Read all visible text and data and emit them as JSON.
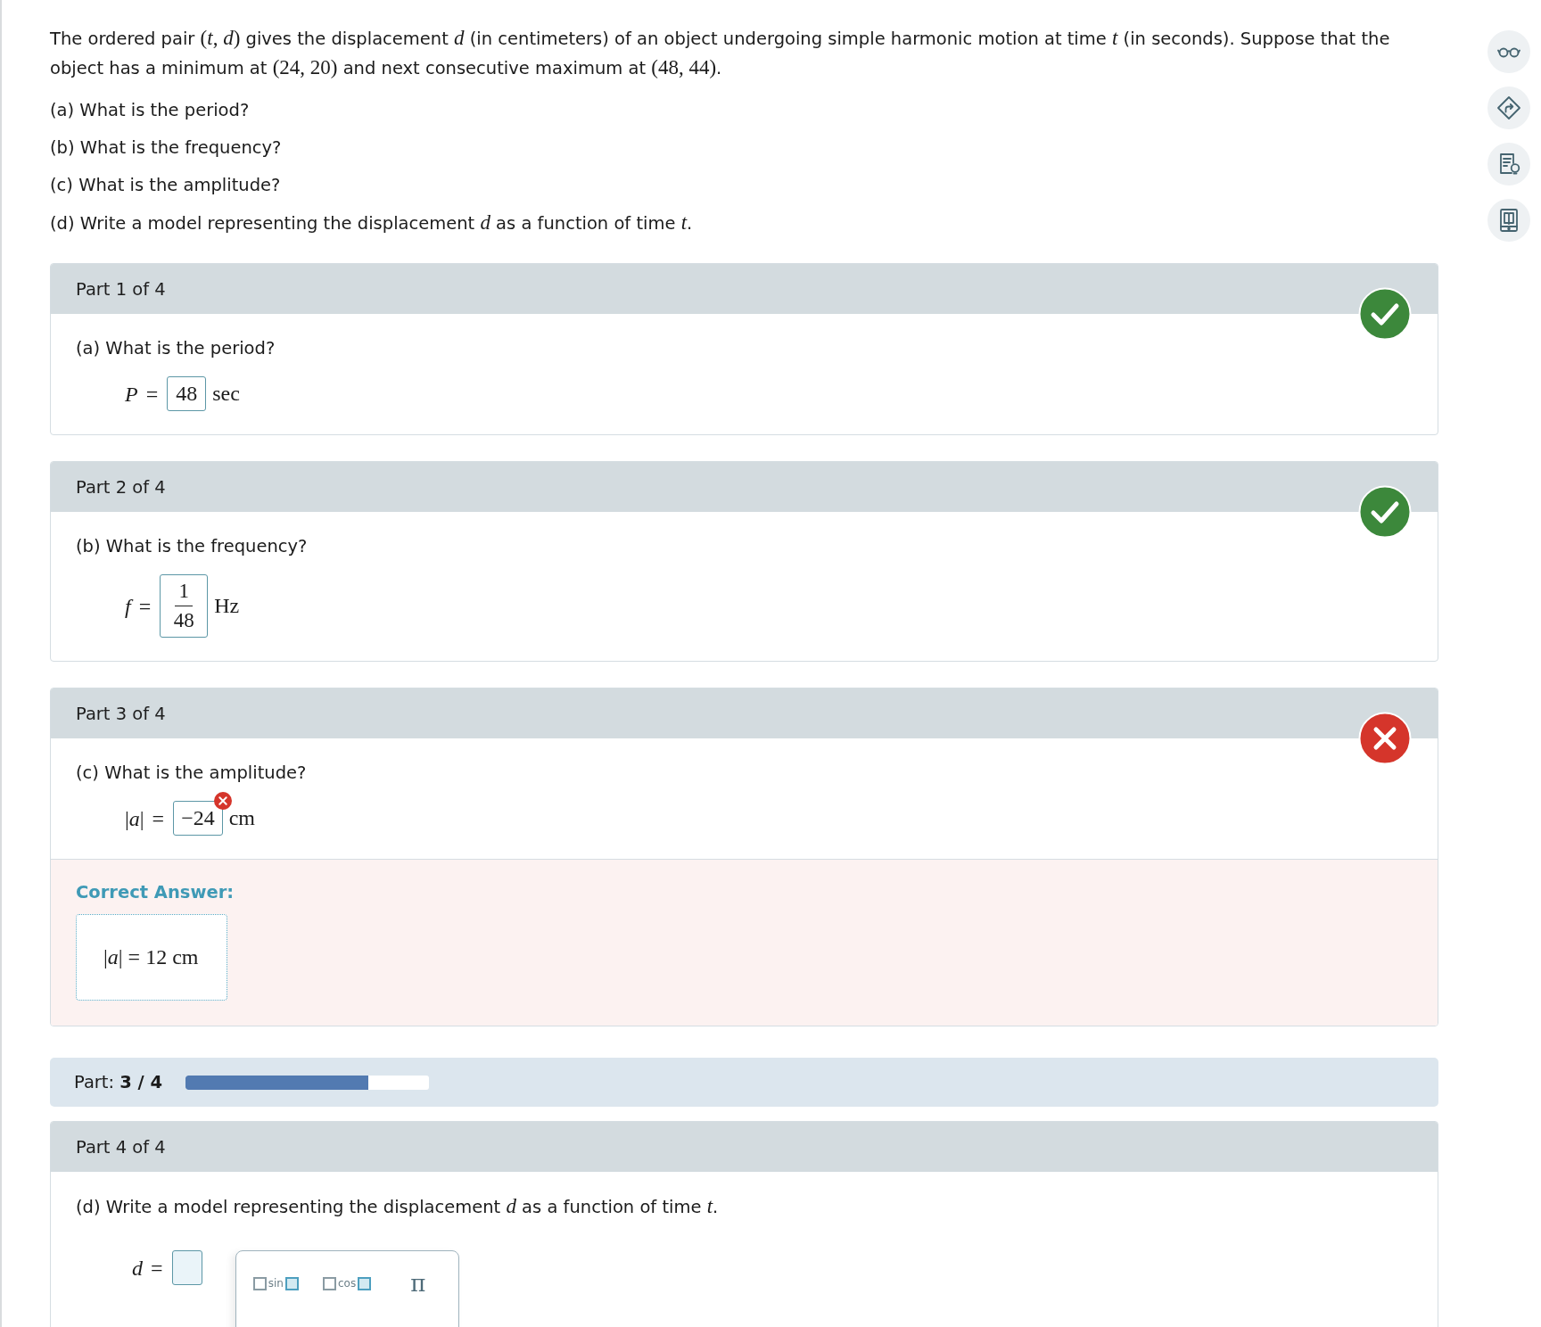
{
  "problem": {
    "statement": [
      {
        "kind": "text",
        "text": "The ordered pair "
      },
      {
        "kind": "math",
        "text": "(*t*, *d*)"
      },
      {
        "kind": "text",
        "text": " gives the displacement "
      },
      {
        "kind": "math",
        "text": "*d*"
      },
      {
        "kind": "text",
        "text": " (in centimeters) of an object undergoing simple harmonic motion at time "
      },
      {
        "kind": "math",
        "text": "*t*"
      },
      {
        "kind": "text",
        "text": " (in seconds). Suppose that the object has a minimum at "
      },
      {
        "kind": "math",
        "text": "(24, 20)"
      },
      {
        "kind": "text",
        "text": " and next consecutive maximum at "
      },
      {
        "kind": "math",
        "text": "(48, 44)"
      },
      {
        "kind": "text",
        "text": "."
      }
    ],
    "questions": [
      {
        "segments": [
          {
            "kind": "text",
            "text": "(a) What is the period?"
          }
        ]
      },
      {
        "segments": [
          {
            "kind": "text",
            "text": "(b) What is the frequency?"
          }
        ]
      },
      {
        "segments": [
          {
            "kind": "text",
            "text": "(c) What is the amplitude?"
          }
        ]
      },
      {
        "segments": [
          {
            "kind": "text",
            "text": "(d) Write a model representing the displacement "
          },
          {
            "kind": "math",
            "text": "*d*"
          },
          {
            "kind": "text",
            "text": " as a function of time "
          },
          {
            "kind": "math",
            "text": "*t*"
          },
          {
            "kind": "text",
            "text": "."
          }
        ]
      }
    ]
  },
  "sections": [
    {
      "kind": "part",
      "header": "Part 1 of 4",
      "correct": true,
      "question": [
        {
          "kind": "text",
          "text": "(a) What is the period?"
        }
      ],
      "answer": {
        "kind": "single",
        "lhs": "*P* =",
        "value": "48",
        "unit": "sec"
      }
    },
    {
      "kind": "part",
      "header": "Part 2 of 4",
      "correct": true,
      "question": [
        {
          "kind": "text",
          "text": "(b) What is the frequency?"
        }
      ],
      "answer": {
        "kind": "fraction",
        "lhs": "*f* =",
        "numerator": "1",
        "denominator": "48",
        "unit": "Hz"
      }
    },
    {
      "kind": "part",
      "header": "Part 3 of 4",
      "correct": false,
      "question": [
        {
          "kind": "text",
          "text": "(c) What is the amplitude?"
        }
      ],
      "answer": {
        "kind": "single",
        "lhs": "|*a*| =",
        "value": "−24",
        "unit": "cm",
        "wrong": true
      },
      "correct_answer": {
        "label": "Correct Answer:",
        "formula": "|*a*| = 12 cm"
      }
    },
    {
      "kind": "progress",
      "label": "Part: **3 / 4**",
      "level": 0.75
    },
    {
      "kind": "part",
      "header": "Part 4 of 4",
      "question": [
        {
          "kind": "text",
          "text": "(d) Write a model representing the displacement "
        },
        {
          "kind": "math",
          "text": "*d*"
        },
        {
          "kind": "text",
          "text": " as a function of time "
        },
        {
          "kind": "math",
          "text": "*t*"
        },
        {
          "kind": "text",
          "text": "."
        }
      ],
      "answer": {
        "kind": "template",
        "lhs": "*d* =",
        "keypad": [
          {
            "kind": "function",
            "label": "sin"
          },
          {
            "kind": "function",
            "label": "cos"
          },
          {
            "kind": "constant",
            "label": "π"
          }
        ]
      }
    }
  ]
}
